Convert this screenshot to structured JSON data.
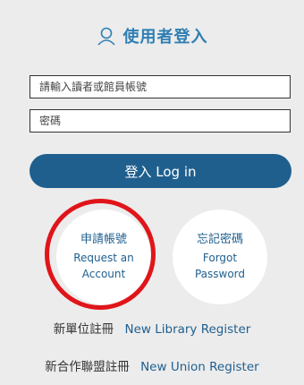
{
  "login_panel": {
    "title": "使用者登入",
    "title_icon": "user-icon",
    "account_field": {
      "placeholder": "請輸入讀者或館員帳號",
      "value": ""
    },
    "password_field": {
      "placeholder": "密碼",
      "value": ""
    },
    "login_button": {
      "label": "登入 Log in"
    },
    "request_account": {
      "label_zh": "申請帳號",
      "label_en_line1": "Request an",
      "label_en_line2": "Account"
    },
    "forgot_password": {
      "label_zh": "忘記密碼",
      "label_en_line1": "Forgot",
      "label_en_line2": "Password"
    },
    "new_library_register": {
      "label_zh": "新單位註冊",
      "label_en": "New Library Register"
    },
    "new_union_register": {
      "label_zh": "新合作聯盟註冊",
      "label_en": "New Union Register"
    }
  },
  "colors": {
    "accent": "#1f5f8e",
    "title": "#2f7fb3",
    "background": "#ececec",
    "highlight": "#e0151a"
  }
}
